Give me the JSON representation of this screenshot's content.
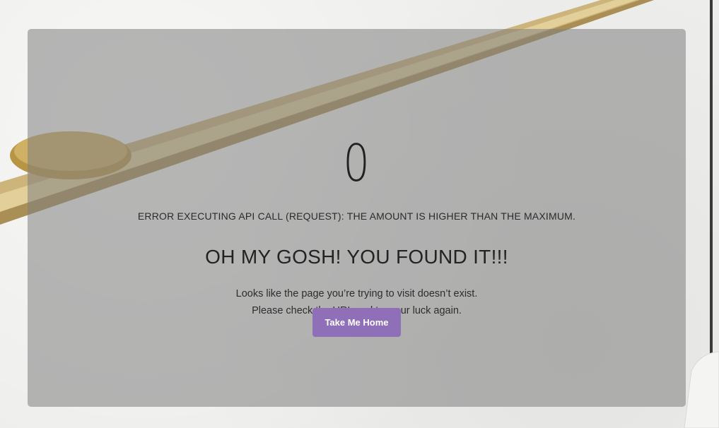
{
  "page": {
    "error_code": "0",
    "error_message": "ERROR EXECUTING API CALL (REQUEST): THE AMOUNT IS HIGHER THAN THE MAXIMUM.",
    "headline": "OH MY GOSH! YOU FOUND IT!!!",
    "message_line1": "Looks like the page you’re trying to visit doesn’t exist.",
    "message_line2": "Please check the URL and try your luck again.",
    "home_button_label": "Take Me Home"
  },
  "colors": {
    "button": "#8e6fb8",
    "card_overlay": "#808080",
    "text": "#222222"
  }
}
